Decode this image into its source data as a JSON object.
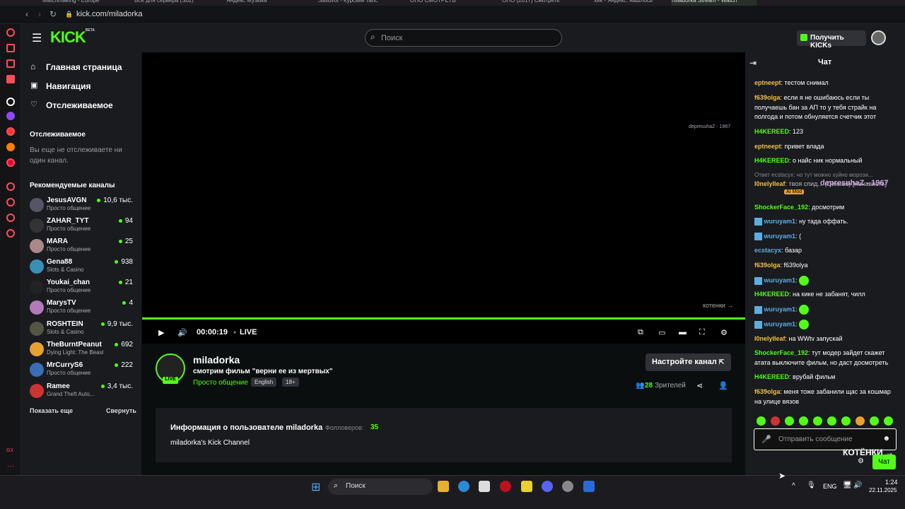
{
  "browser": {
    "url": "kick.com/miladorka",
    "tabs": [
      "Matchmaking - Europe",
      "Все для сервера (Soz)",
      "Яндекс Музыка",
      "Sasdvot - Курский тапс",
      "ОПО СМОТРЕТЬ",
      "ОПО (2017) Смотреть",
      "хик - Яндекс: нашлось",
      "miladorka Stream - Watch"
    ]
  },
  "header": {
    "logo": "KICK",
    "logo_beta": "BETA",
    "search_placeholder": "Поиск",
    "get_kicks": "Получить KICKs"
  },
  "sidebar": {
    "nav": [
      "Главная страница",
      "Навигация",
      "Отслеживаемое"
    ],
    "following_title": "Отслеживаемое",
    "following_empty": "Вы еще не отслеживаете ни один канал.",
    "recommended_title": "Рекомендуемые каналы",
    "channels": [
      {
        "name": "JesusAVGN",
        "category": "Просто общение",
        "viewers": "10,6 тыс."
      },
      {
        "name": "ZAHAR_TYT",
        "category": "Просто общение",
        "viewers": "94"
      },
      {
        "name": "MARA",
        "category": "Просто общение",
        "viewers": "25"
      },
      {
        "name": "Gena88",
        "category": "Slots & Casino",
        "viewers": "938"
      },
      {
        "name": "Youkai_chan",
        "category": "Просто общение",
        "viewers": "21"
      },
      {
        "name": "MarysTV",
        "category": "Просто общение",
        "viewers": "4"
      },
      {
        "name": "ROSHTEIN",
        "category": "Slots & Casino",
        "viewers": "9,9 тыс."
      },
      {
        "name": "TheBurntPeanut",
        "category": "Dying Light: The Beast",
        "viewers": "692"
      },
      {
        "name": "MrCurryS6",
        "category": "Просто общение",
        "viewers": "222"
      },
      {
        "name": "Ramee",
        "category": "Grand Theft Auto...",
        "viewers": "3,4 тыс."
      }
    ],
    "show_more": "Показать еще",
    "collapse": "Свернуть"
  },
  "player": {
    "watermark_top": "depresuhaZ - 1967",
    "watermark_bottom": "котенки →",
    "time": "00:00:19",
    "live": "LIVE"
  },
  "channel": {
    "name": "miladorka",
    "title": "смотрим фильм \"верни ее из мертвых\"",
    "category": "Просто общение",
    "tags": [
      "English",
      "18+"
    ],
    "live_badge": "LIVE",
    "setup_button": "Настройте канал",
    "viewers": "28",
    "viewers_label": "Зрителей"
  },
  "about": {
    "title": "Информация о пользователе miladorka",
    "followers_label": "Фолловеров:",
    "followers": "35",
    "description": "miladorka's Kick Channel"
  },
  "chat": {
    "title": "Чат",
    "messages": [
      {
        "user": "eptneept",
        "color": "#f0c040",
        "text": "тестом снимал"
      },
      {
        "user": "f639olga",
        "color": "#f0c040",
        "text": "если я не ошибаюсь если ты получаешь бан за АП то у тебя страйк на полгода и потом обнуляется счетчик этот"
      },
      {
        "user": "H4KEREED",
        "color": "#53fc18",
        "text": "123"
      },
      {
        "user": "eptneept",
        "color": "#f0c040",
        "text": "привет влада"
      },
      {
        "user": "H4KEREED",
        "color": "#53fc18",
        "text": "о найс ник нормальный"
      },
      {
        "user": "l0nelylleaf",
        "color": "#f0c040",
        "text": "твоя спид... (Deleted) [ненависть]"
      },
      {
        "user": "ShockerFace_192",
        "color": "#53fc18",
        "text": "досмотрим"
      },
      {
        "user": "wuruyam1",
        "color": "#5dade2",
        "text": "ну тада оффать."
      },
      {
        "user": "wuruyam1",
        "color": "#5dade2",
        "text": "("
      },
      {
        "user": "ecstacyx",
        "color": "#5dade2",
        "text": "базар"
      },
      {
        "user": "f639olga",
        "color": "#f0c040",
        "text": "f639olya"
      },
      {
        "user": "wuruyam1",
        "color": "#5dade2",
        "text": ""
      },
      {
        "user": "H4KEREED",
        "color": "#53fc18",
        "text": "на кике не забанят, чилл"
      },
      {
        "user": "wuruyam1",
        "color": "#5dade2",
        "text": ""
      },
      {
        "user": "wuruyam1",
        "color": "#5dade2",
        "text": ""
      },
      {
        "user": "l0nelylleaf",
        "color": "#f0c040",
        "text": "на WWtv запускай"
      },
      {
        "user": "ShockerFace_192",
        "color": "#53fc18",
        "text": "тут модер зайдет скажет атата выключите фильм, но даст досмотреть"
      },
      {
        "user": "H4KEREED",
        "color": "#53fc18",
        "text": "врубай фильм"
      },
      {
        "user": "f639olga",
        "color": "#f0c040",
        "text": "меня тоже забанили щас за кошмар на улице вязов"
      }
    ],
    "reply_line": "Ответ ecstacyx: чо тут можно хуйно морози...",
    "overlay": "depresuhaZ - 1967",
    "ai_mod": "AI Mod",
    "input_placeholder": "Отправить сообщение",
    "overlay_bottom": "КОТЁНКИ →",
    "send": "Чат"
  },
  "taskbar": {
    "search": "Поиск",
    "lang": "ENG",
    "time": "1:24",
    "date": "22.11.2025"
  }
}
